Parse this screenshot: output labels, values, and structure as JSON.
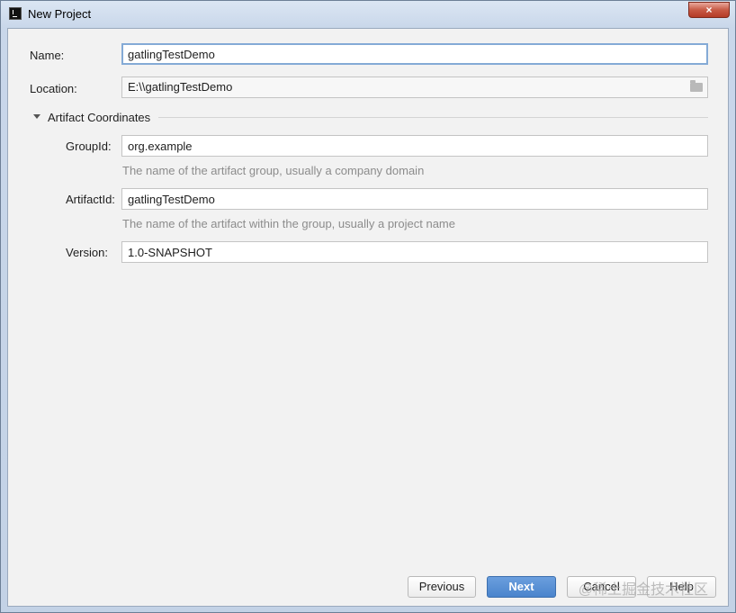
{
  "window": {
    "title": "New Project",
    "close_glyph": "×"
  },
  "form": {
    "name": {
      "label": "Name:",
      "value": "gatlingTestDemo"
    },
    "location": {
      "label": "Location:",
      "value": "E:\\\\gatlingTestDemo",
      "icon": "folder-icon"
    },
    "artifact_section": {
      "title": "Artifact Coordinates",
      "expanded": true
    },
    "group_id": {
      "label": "GroupId:",
      "value": "org.example",
      "hint": "The name of the artifact group, usually a company domain"
    },
    "artifact_id": {
      "label": "ArtifactId:",
      "value": "gatlingTestDemo",
      "hint": "The name of the artifact within the group, usually a project name"
    },
    "version": {
      "label": "Version:",
      "value": "1.0-SNAPSHOT"
    }
  },
  "buttons": {
    "previous": "Previous",
    "next": "Next",
    "cancel": "Cancel",
    "help": "Help"
  },
  "watermark": "@稀土掘金技术社区",
  "colors": {
    "accent": "#4a84cc",
    "focus_border": "#84aad6",
    "close": "#c75a45"
  }
}
